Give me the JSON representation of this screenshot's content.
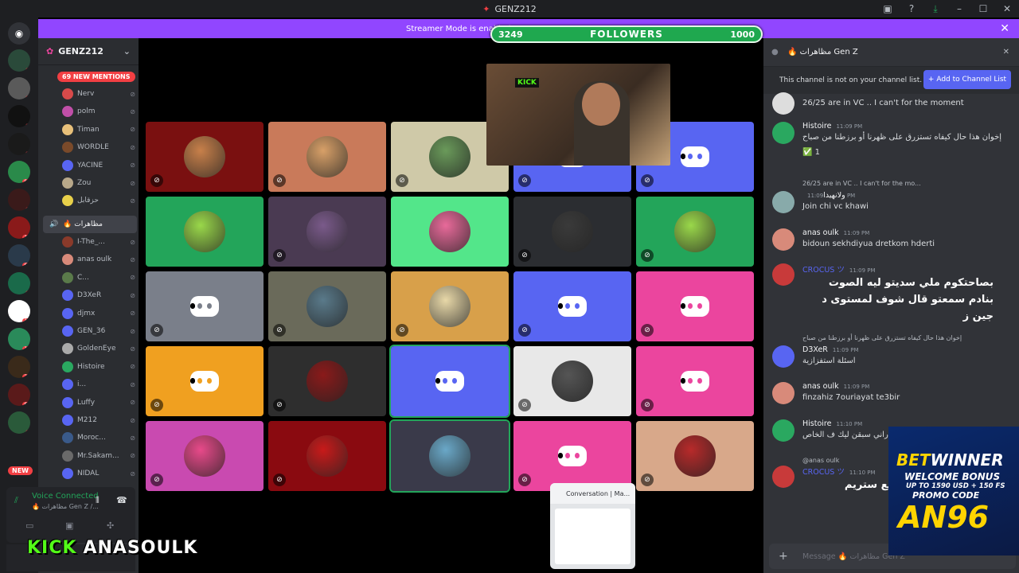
{
  "window": {
    "title": "GENZ212"
  },
  "banner": {
    "text": "Streamer Mode is enabled"
  },
  "followers": {
    "current": "3249",
    "label": "FOLLOWERS",
    "goal": "1000"
  },
  "rail_badges": [
    "2",
    "1",
    "8",
    "6",
    "94",
    "3",
    "18",
    "66",
    "2",
    "19",
    "17",
    "20",
    "69",
    "2"
  ],
  "rail_new": "NEW",
  "server": {
    "name": "GENZ212",
    "mentions": "69 NEW MENTIONS"
  },
  "members_top": [
    {
      "name": "Nerv",
      "color": "#d84a4a"
    },
    {
      "name": "polm",
      "color": "#c04fa8"
    },
    {
      "name": "Timan",
      "color": "#e8c07a"
    },
    {
      "name": "WORDLE",
      "color": "#7a4a2a"
    },
    {
      "name": "YACINE",
      "color": "#5865f2"
    },
    {
      "name": "Zou",
      "color": "#b8a88a"
    },
    {
      "name": "حزقابل",
      "color": "#e8d04a"
    }
  ],
  "voice_channel": {
    "name": "🔥 مظاهرات"
  },
  "members_vc": [
    {
      "name": "I-The_...",
      "color": "#8a3a2a"
    },
    {
      "name": "anas oulk",
      "color": "#d88a7a"
    },
    {
      "name": "C...",
      "color": "#5a7a4a"
    },
    {
      "name": "D3XeR",
      "color": "#5865f2"
    },
    {
      "name": "djmx",
      "color": "#5865f2"
    },
    {
      "name": "GEN_36",
      "color": "#5865f2"
    },
    {
      "name": "GoldenEye",
      "color": "#aaa"
    },
    {
      "name": "Histoire",
      "color": "#2aa860"
    },
    {
      "name": "i...",
      "color": "#5865f2"
    },
    {
      "name": "Luffy",
      "color": "#5865f2"
    },
    {
      "name": "M212",
      "color": "#5865f2"
    },
    {
      "name": "Moroc...",
      "color": "#3a5a8a"
    },
    {
      "name": "Mr.Sakam...",
      "color": "#6a6a6a"
    },
    {
      "name": "NIDAL",
      "color": "#5865f2"
    }
  ],
  "voice_panel": {
    "status": "Voice Connected",
    "channel": "🔥 مظاهرات Gen Z /..."
  },
  "kick": {
    "brand": "KICK",
    "user": "ANASOULK"
  },
  "tiles": [
    {
      "bg": "#7a1010",
      "kind": "avatar",
      "av": "#c8804a",
      "muted": true
    },
    {
      "bg": "#c97a5a",
      "kind": "avatar",
      "av": "#d8a068",
      "muted": true
    },
    {
      "bg": "#cfc9a8",
      "kind": "avatar",
      "av": "#6a9a5a",
      "muted": true
    },
    {
      "bg": "#5865f2",
      "kind": "discord",
      "muted": true
    },
    {
      "bg": "#5865f2",
      "kind": "discord",
      "muted": true
    },
    {
      "bg": "#23a55a",
      "kind": "avatar",
      "av": "#9ad84a",
      "muted": false
    },
    {
      "bg": "#4a3a52",
      "kind": "avatar",
      "av": "#7a5a8a",
      "muted": true
    },
    {
      "bg": "#53e68a",
      "kind": "avatar",
      "av": "#e86a9a",
      "muted": false
    },
    {
      "bg": "#2b2d31",
      "kind": "avatar",
      "av": "#3a3a3a",
      "muted": true
    },
    {
      "bg": "#23a55a",
      "kind": "avatar",
      "av": "#9ad84a",
      "muted": true
    },
    {
      "bg": "#7a7f8a",
      "kind": "discord",
      "muted": true
    },
    {
      "bg": "#6a6a5a",
      "kind": "avatar",
      "av": "#5a7a8a",
      "muted": true
    },
    {
      "bg": "#d8a04a",
      "kind": "avatar",
      "av": "#e8d8a8",
      "muted": true
    },
    {
      "bg": "#5865f2",
      "kind": "discord",
      "muted": true
    },
    {
      "bg": "#eb459e",
      "kind": "discord",
      "muted": true
    },
    {
      "bg": "#f0a020",
      "kind": "discord",
      "muted": true
    },
    {
      "bg": "#2e2e2e",
      "kind": "avatar",
      "av": "#8a1a1a",
      "muted": true
    },
    {
      "bg": "#5865f2",
      "kind": "discord",
      "muted": false,
      "sel": true
    },
    {
      "bg": "#e8e8e8",
      "kind": "avatar",
      "av": "#555",
      "muted": true
    },
    {
      "bg": "#eb459e",
      "kind": "discord",
      "muted": true
    },
    {
      "bg": "#c94ab0",
      "kind": "avatar",
      "av": "#e84a8a",
      "muted": true
    },
    {
      "bg": "#8a0a10",
      "kind": "avatar",
      "av": "#c81a1a",
      "muted": true
    },
    {
      "bg": "#3a3a4a",
      "kind": "avatar",
      "av": "#6aa8c8",
      "muted": false,
      "sel": true
    },
    {
      "bg": "#eb459e",
      "kind": "discord",
      "muted": true
    },
    {
      "bg": "#d8a88a",
      "kind": "avatar",
      "av": "#b82a2a",
      "muted": true
    }
  ],
  "stream": {
    "kick_text": "KICK"
  },
  "popup": {
    "title": "Conversation | Ma..."
  },
  "chat": {
    "channel": "🔥 مظاهرات Gen Z",
    "notice": "This channel is not on your channel list.",
    "add_button": "Add to Channel List",
    "composer_placeholder": "Message 🔥 مظاهرات Gen Z",
    "messages": [
      {
        "author": "",
        "time": "",
        "text": "26/25 are in VC .. I can't for the moment",
        "color": "#ddd"
      },
      {
        "author": "Histoire",
        "time": "11:09 PM",
        "text": "إخوان هذا حال كيفاه تستزرق على ظهرنا أو برزطنا من صباح",
        "color": "#2aa860"
      },
      {
        "author": "",
        "time": "",
        "text": "✅ 1",
        "color": ""
      },
      {
        "author": "ولانهيدا",
        "time": "11:09 PM",
        "text": "Join chi vc khawi",
        "color": "#8aa"
      },
      {
        "author": "anas oulk",
        "time": "11:09 PM",
        "text": "bidoun sekhdiyua dretkom hderti",
        "color": "#d88a7a"
      },
      {
        "author": "CROCUS ツ",
        "time": "11:09 PM",
        "text": "بصاحتكوم ملي سديتو ليه الصوت بنادم سمعتو قال شوف لمستوى د جين ز",
        "color": "#c83a3a"
      },
      {
        "author": "D3XeR",
        "time": "11:09 PM",
        "text": "اسئلة استفزازية",
        "color": "#5865f2"
      },
      {
        "author": "anas oulk",
        "time": "11:09 PM",
        "text": "finzahiz 7ouriayat te3bir",
        "color": "#d88a7a"
      },
      {
        "author": "Histoire",
        "time": "11:10 PM",
        "text": "انت راني سبقن ليك ف الخاص",
        "color": "#2aa860"
      },
      {
        "author": "CROCUS ツ",
        "time": "11:10 PM",
        "text": "غفز فدراري باش طلع ستريم",
        "color": "#c83a3a"
      }
    ],
    "replies": [
      "26/25 are in VC .. I can't for the mo...",
      "إخوان هذا حال كيفاه تستزرق على ظهرنا أو برزطنا من صباح",
      "@anas oulk"
    ]
  },
  "ad": {
    "brand_a": "BET",
    "brand_b": "WINNER",
    "line1": "WELCOME BONUS",
    "line2": "UP TO 1590 USD + 150 FS",
    "line3": "PROMO CODE",
    "code": "AN96"
  }
}
